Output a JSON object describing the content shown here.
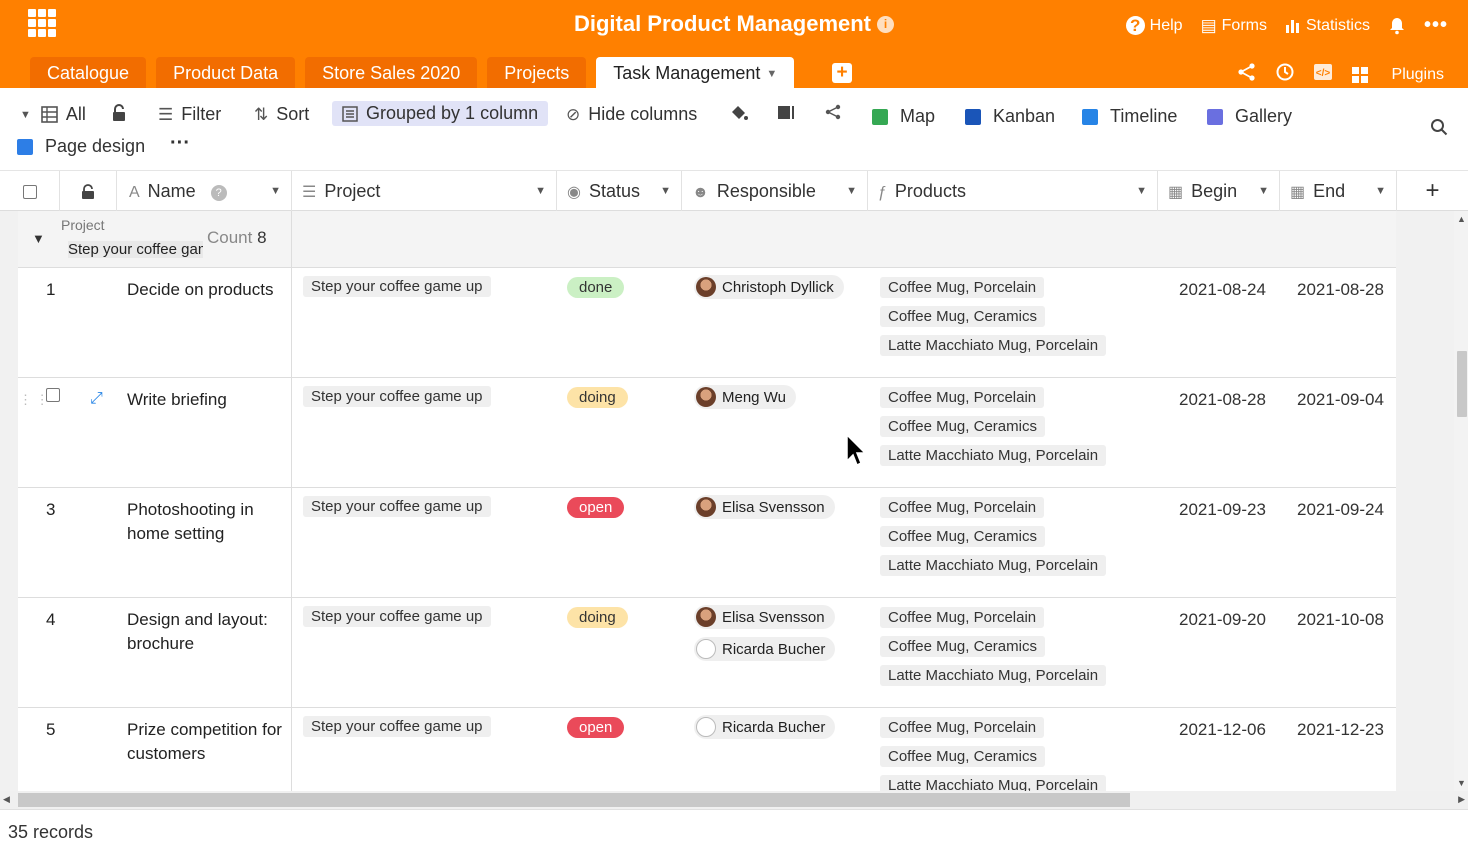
{
  "header": {
    "title": "Digital Product Management",
    "help": "Help",
    "forms": "Forms",
    "statistics": "Statistics",
    "plugins": "Plugins"
  },
  "tabs": [
    {
      "label": "Catalogue",
      "active": false
    },
    {
      "label": "Product Data",
      "active": false
    },
    {
      "label": "Store Sales 2020",
      "active": false
    },
    {
      "label": "Projects",
      "active": false
    },
    {
      "label": "Task Management",
      "active": true
    }
  ],
  "toolbar": {
    "all": "All",
    "filter": "Filter",
    "sort": "Sort",
    "grouped": "Grouped by 1 column",
    "hide_columns": "Hide columns",
    "map": "Map",
    "kanban": "Kanban",
    "timeline": "Timeline",
    "gallery": "Gallery",
    "page_design": "Page design",
    "more": "···"
  },
  "columns": {
    "name": "Name",
    "project": "Project",
    "status": "Status",
    "responsible": "Responsible",
    "products": "Products",
    "begin": "Begin",
    "end": "End"
  },
  "group": {
    "field": "Project",
    "value": "Step your coffee game up",
    "count_label": "Count",
    "count": "8"
  },
  "rows": [
    {
      "num": "1",
      "name": "Decide on products",
      "project": "Step your coffee game up",
      "status": "done",
      "responsible": [
        "Christoph Dyllick"
      ],
      "products": [
        "Coffee Mug, Porcelain",
        "Coffee Mug, Ceramics",
        "Latte Macchiato Mug, Porcelain"
      ],
      "begin": "2021-08-24",
      "end": "2021-08-28"
    },
    {
      "num": "",
      "name": "Write briefing",
      "project": "Step your coffee game up",
      "status": "doing",
      "responsible": [
        "Meng Wu"
      ],
      "products": [
        "Coffee Mug, Porcelain",
        "Coffee Mug, Ceramics",
        "Latte Macchiato Mug, Porcelain"
      ],
      "begin": "2021-08-28",
      "end": "2021-09-04"
    },
    {
      "num": "3",
      "name": "Photoshooting in home setting",
      "project": "Step your coffee game up",
      "status": "open",
      "responsible": [
        "Elisa Svensson"
      ],
      "products": [
        "Coffee Mug, Porcelain",
        "Coffee Mug, Ceramics",
        "Latte Macchiato Mug, Porcelain"
      ],
      "begin": "2021-09-23",
      "end": "2021-09-24"
    },
    {
      "num": "4",
      "name": "Design and layout: brochure",
      "project": "Step your coffee game up",
      "status": "doing",
      "responsible": [
        "Elisa Svensson",
        "Ricarda Bucher"
      ],
      "products": [
        "Coffee Mug, Porcelain",
        "Coffee Mug, Ceramics",
        "Latte Macchiato Mug, Porcelain"
      ],
      "begin": "2021-09-20",
      "end": "2021-10-08"
    },
    {
      "num": "5",
      "name": "Prize competition for customers",
      "project": "Step your coffee game up",
      "status": "open",
      "responsible": [
        "Ricarda Bucher"
      ],
      "products": [
        "Coffee Mug, Porcelain",
        "Coffee Mug, Ceramics",
        "Latte Macchiato Mug, Porcelain"
      ],
      "begin": "2021-12-06",
      "end": "2021-12-23"
    }
  ],
  "footer": {
    "records": "35 records"
  },
  "colors": {
    "brand": "#ff8000",
    "done": "#cbf0c4",
    "doing": "#fde3a7",
    "open": "#ea4a5a"
  }
}
